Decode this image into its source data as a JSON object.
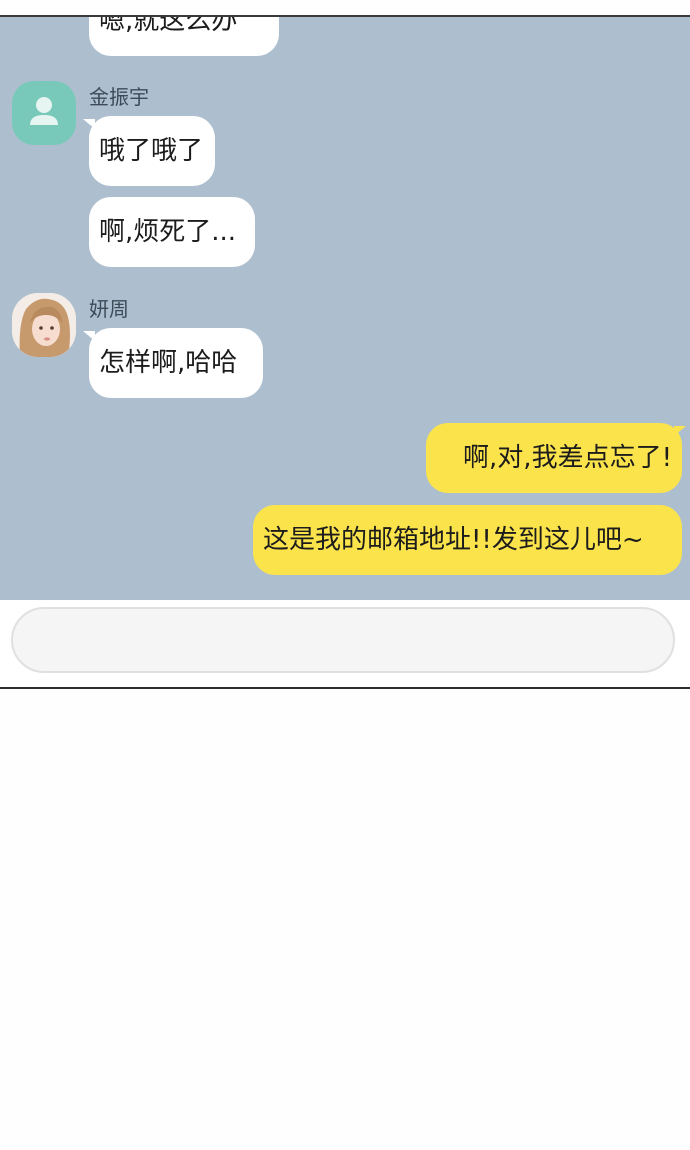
{
  "chat": {
    "messages": [
      {
        "text": "嗯,就这么办"
      },
      {
        "text": "哦了哦了"
      },
      {
        "text": "啊,烦死了..."
      },
      {
        "text": "怎样啊,哈哈"
      },
      {
        "text": "啊,对,我差点忘了!"
      },
      {
        "text": "这是我的邮箱地址!!发到这儿吧~"
      }
    ],
    "senders": {
      "jin": "金振宇",
      "yeon": "妍周"
    },
    "icons": {
      "default_avatar": "person-icon",
      "photo_avatar": "profile-photo"
    }
  },
  "composer": {
    "placeholder": ""
  },
  "colors": {
    "chat_background": "#adbfcf",
    "incoming_bubble": "#ffffff",
    "outgoing_bubble": "#fbe34c",
    "default_avatar": "#79c9bb"
  }
}
